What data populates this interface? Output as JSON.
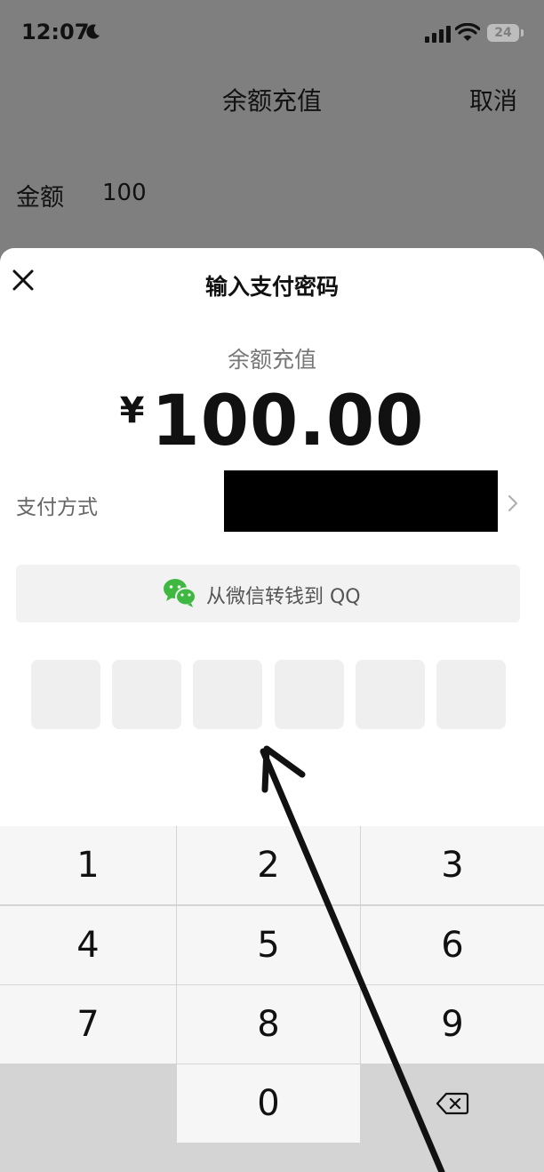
{
  "status_bar": {
    "time": "12:07",
    "battery": "24"
  },
  "background_page": {
    "title": "余额充值",
    "cancel_label": "取消",
    "amount_label": "金额",
    "amount_value": "100"
  },
  "payment_sheet": {
    "title": "输入支付密码",
    "purpose": "余额充值",
    "currency": "¥",
    "amount": "100.00",
    "method_label": "支付方式",
    "transfer_label": "从微信转钱到 QQ",
    "pin_length": 6
  },
  "keypad": {
    "keys": [
      "1",
      "2",
      "3",
      "4",
      "5",
      "6",
      "7",
      "8",
      "9",
      "",
      "0",
      "⌫"
    ]
  },
  "colors": {
    "wechat_green": "#3fb842",
    "overlay_gray": "#7f7f7f",
    "key_bg": "#f6f6f6",
    "key_dark_bg": "#d4d4d4"
  }
}
